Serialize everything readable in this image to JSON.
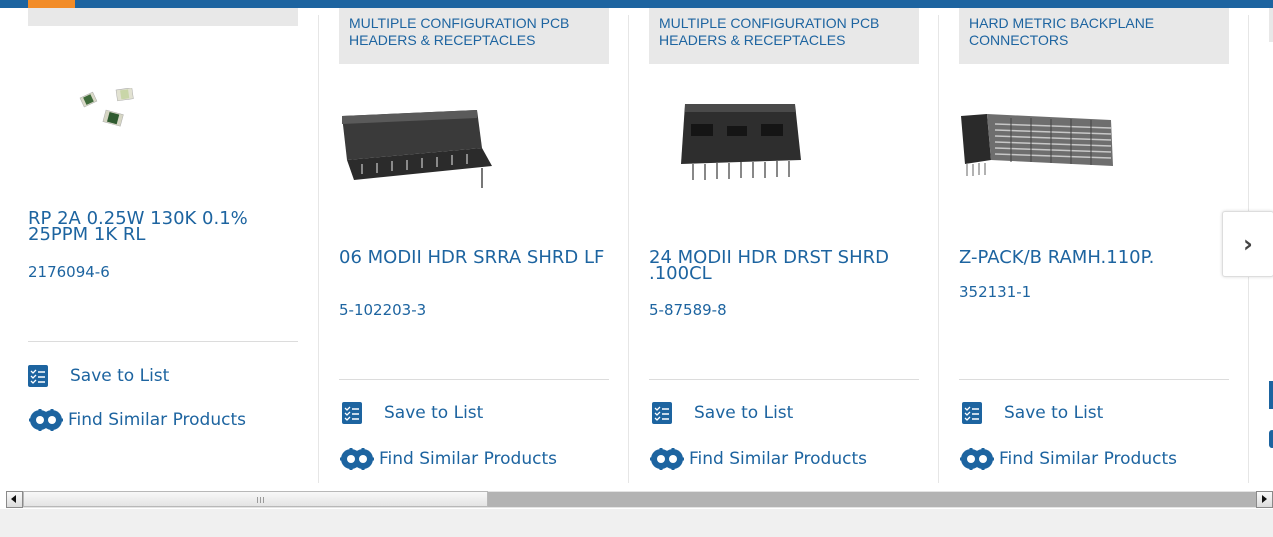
{
  "carousel": {
    "cards": [
      {
        "category": "",
        "title": "RP 2A 0.25W 130K 0.1% 25PPM 1K RL",
        "part_number": "2176094-6",
        "image_icon": "smd-resistor-icon"
      },
      {
        "category": "MULTIPLE CONFIGURATION PCB HEADERS & RECEPTACLES",
        "title": "06 MODII HDR SRRA SHRD LF",
        "part_number": "5-102203-3",
        "image_icon": "right-angle-header-icon"
      },
      {
        "category": "MULTIPLE CONFIGURATION PCB HEADERS & RECEPTACLES",
        "title": "24 MODII HDR DRST SHRD .100CL",
        "part_number": "5-87589-8",
        "image_icon": "dual-row-header-icon"
      },
      {
        "category": "HARD METRIC BACKPLANE CONNECTORS",
        "title": "Z-PACK/B RAMH.110P.",
        "part_number": "352131-1",
        "image_icon": "backplane-connector-icon"
      }
    ],
    "save_label": "Save to List",
    "similar_label": "Find Similar Products",
    "next_symbol": "›"
  },
  "colors": {
    "brand_blue": "#1d64a0",
    "accent_orange": "#f28c28",
    "category_bg": "#e8e8e8"
  }
}
